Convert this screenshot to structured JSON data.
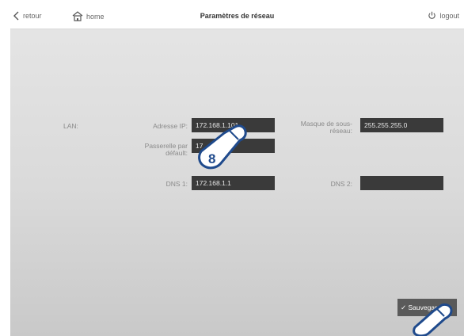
{
  "header": {
    "back_label": "retour",
    "home_label": "home",
    "title": "Paramètres de réseau",
    "logout_label": "logout"
  },
  "form": {
    "section_label": "LAN:",
    "ip_label": "Adresse IP:",
    "ip_value": "172.168.1.101",
    "mask_label_line1": "Masque de sous-",
    "mask_label_line2": "réseau:",
    "mask_value": "255.255.255.0",
    "gateway_label_line1": "Passerelle par",
    "gateway_label_line2": "défault:",
    "gateway_value_visible": "17",
    "dns1_label": "DNS 1:",
    "dns1_value": "172.168.1.1",
    "dns2_label": "DNS 2:",
    "dns2_value": ""
  },
  "actions": {
    "save_label": "✓ Sauvegarder"
  },
  "overlay": {
    "step_number": "8"
  },
  "colors": {
    "field_bg": "#3a3a3a",
    "accent_blue": "#1f4a8c",
    "button_bg": "#5a5a5a"
  }
}
